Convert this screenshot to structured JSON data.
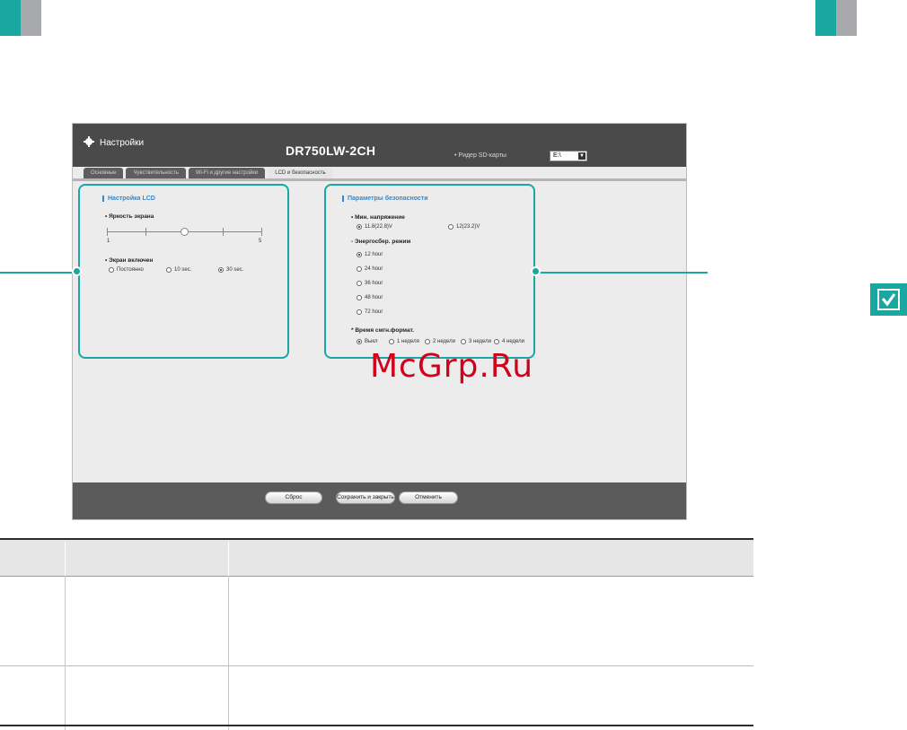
{
  "window": {
    "title": "Настройки",
    "model": "DR750LW-2CH",
    "sd_label": "• Ридер SD-карты",
    "sd_value": "E:\\"
  },
  "tabs": [
    {
      "label": "Основные",
      "active": false
    },
    {
      "label": "Чувствительность",
      "active": false
    },
    {
      "label": "Wi-Fi и другие настройки",
      "active": false
    },
    {
      "label": "LCD и безопасность",
      "active": true
    }
  ],
  "lcd": {
    "title": "Настройка LCD",
    "brightness_label": "• Яркость экрана",
    "brightness_min": "1",
    "brightness_max": "5",
    "brightness_level": 3,
    "screen_on_label": "• Экран включен",
    "screen_on_options": [
      {
        "label": "Постоянно",
        "selected": false
      },
      {
        "label": "10 sec.",
        "selected": false
      },
      {
        "label": "30 sec.",
        "selected": true
      }
    ]
  },
  "security": {
    "title": "Параметры безопасности",
    "min_voltage_label": "• Мин. напряжение",
    "voltage_options": [
      {
        "label": "11.8(22.8)V",
        "selected": true
      },
      {
        "label": "12(23.2)V",
        "selected": false
      }
    ],
    "power_save_label": "- Энергосбер. режим",
    "power_save_options": [
      {
        "label": "12 hour",
        "selected": true
      },
      {
        "label": "24 hour",
        "selected": false
      },
      {
        "label": "36 hour",
        "selected": false
      },
      {
        "label": "48 hour",
        "selected": false
      },
      {
        "label": "72 hour",
        "selected": false
      }
    ],
    "format_label": "* Время смгн.формат.",
    "format_options": [
      {
        "label": "Выкл",
        "selected": true
      },
      {
        "label": "1 неделя",
        "selected": false
      },
      {
        "label": "2 недели",
        "selected": false
      },
      {
        "label": "3 недели",
        "selected": false
      },
      {
        "label": "4 недели",
        "selected": false
      }
    ]
  },
  "footer": {
    "reset_label": "Сброс",
    "save_label": "Сохранить и закрыть",
    "cancel_label": "Отменить"
  },
  "watermark": "McGrp.Ru",
  "colors": {
    "accent": "#1aa7a1",
    "section_title": "#3b86c4",
    "watermark": "#d0021b"
  }
}
